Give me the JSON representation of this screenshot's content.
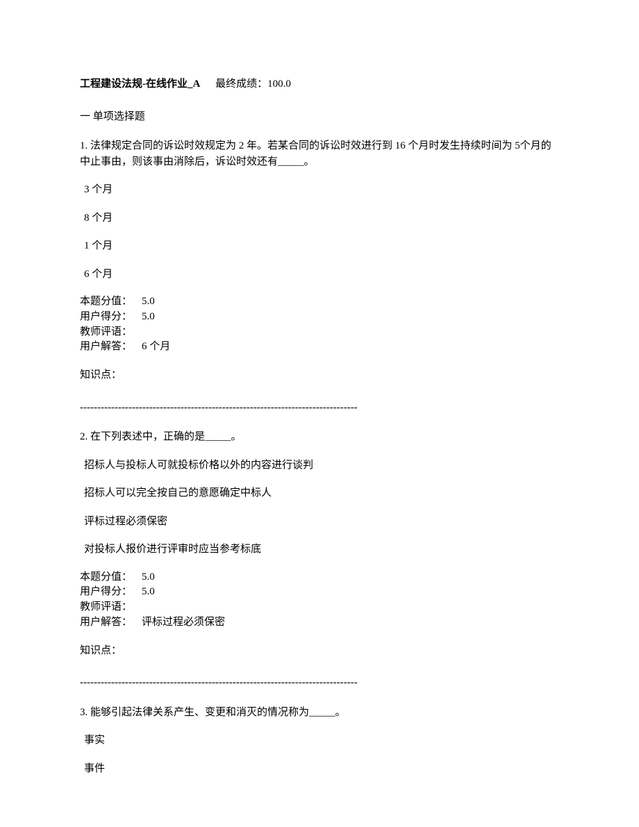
{
  "header": {
    "title": "工程建设法规-在线作业_A",
    "score_label": "最终成绩：",
    "score_value": "100.0"
  },
  "section_title": "一  单项选择题",
  "questions": [
    {
      "text": "1.  法律规定合同的诉讼时效规定为 2 年。若某合同的诉讼时效进行到 16 个月时发生持续时间为 5个月的中止事由，则该事由消除后，诉讼时效还有_____。",
      "options": [
        "3 个月",
        "8 个月",
        "1 个月",
        "6 个月"
      ],
      "score_label": "本题分值：",
      "score_value": "5.0",
      "user_score_label": "用户得分：",
      "user_score_value": "5.0",
      "teacher_label": "教师评语：",
      "teacher_value": "",
      "answer_label": "用户解答：",
      "answer_value": "6 个月",
      "kp_label": "知识点："
    },
    {
      "text": "2.  在下列表述中，正确的是_____。",
      "options": [
        "招标人与投标人可就投标价格以外的内容进行谈判",
        "招标人可以完全按自己的意愿确定中标人",
        "评标过程必须保密",
        "对投标人报价进行评审时应当参考标底"
      ],
      "score_label": "本题分值：",
      "score_value": "5.0",
      "user_score_label": "用户得分：",
      "user_score_value": "5.0",
      "teacher_label": "教师评语：",
      "teacher_value": "",
      "answer_label": "用户解答：",
      "answer_value": "评标过程必须保密",
      "kp_label": "知识点："
    },
    {
      "text": "3.  能够引起法律关系产生、变更和消灭的情况称为_____。",
      "options": [
        "事实",
        "事件"
      ]
    }
  ],
  "separator": "--------------------------------------------------------------------------------"
}
